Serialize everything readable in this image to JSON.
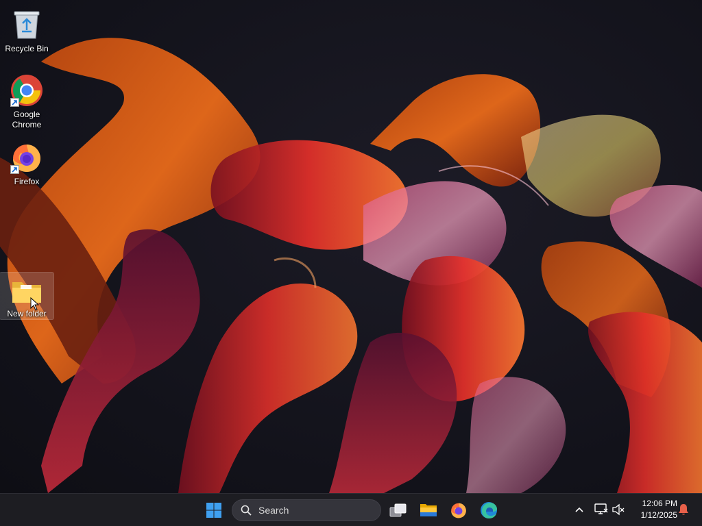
{
  "desktop": {
    "icons": [
      {
        "label": "Recycle Bin",
        "icon": "recycle-bin-icon"
      },
      {
        "label": "Google Chrome",
        "icon": "chrome-icon"
      },
      {
        "label": "Firefox",
        "icon": "firefox-icon"
      },
      {
        "label": "New folder",
        "icon": "folder-icon",
        "selected": true
      }
    ]
  },
  "taskbar": {
    "start_icon": "windows-start-icon",
    "search": {
      "placeholder": "Search"
    },
    "pinned": [
      {
        "name": "Task View",
        "icon": "task-view-icon"
      },
      {
        "name": "File Explorer",
        "icon": "file-explorer-icon"
      },
      {
        "name": "Firefox",
        "icon": "firefox-icon"
      },
      {
        "name": "Microsoft Edge",
        "icon": "edge-icon"
      }
    ],
    "tray": {
      "icons": [
        "chevron-up-icon",
        "network-icon",
        "volume-muted-icon",
        "notification-bell-icon"
      ],
      "time": "12:06 PM",
      "date": "1/12/2025"
    }
  },
  "colors": {
    "taskbar_bg": "#1d1d22",
    "search_bg": "#34343b",
    "windows_blue": "#3fa0f0",
    "notification": "#e8604a"
  }
}
